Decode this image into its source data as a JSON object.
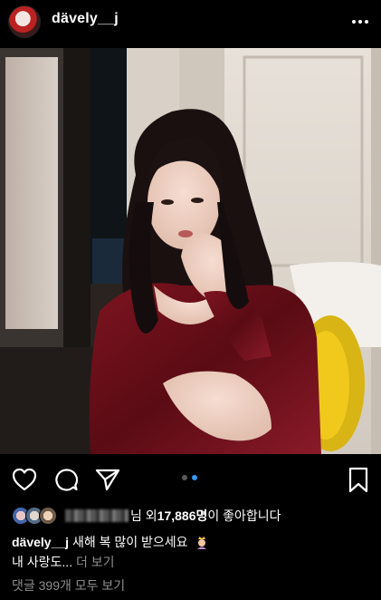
{
  "post": {
    "username": "dävely__j",
    "likes_prefix": "님 외 ",
    "likes_count": "17,886명",
    "likes_suffix": "이 좋아합니다",
    "caption_username": "dävely__j",
    "caption_text": "새해 복 많이 받으세요",
    "caption_line2": "내 사랑도...",
    "more_label": "더 보기",
    "comments_link": "댓글 399개 모두 보기",
    "carousel": {
      "count": 2,
      "active_index": 1
    }
  },
  "icons": {
    "more": "more-horizontal-icon",
    "like": "heart-icon",
    "comment": "comment-icon",
    "share": "send-icon",
    "save": "bookmark-icon"
  },
  "colors": {
    "background": "#000000",
    "active_dot": "#3797f0",
    "muted_text": "#8e8e8e"
  }
}
